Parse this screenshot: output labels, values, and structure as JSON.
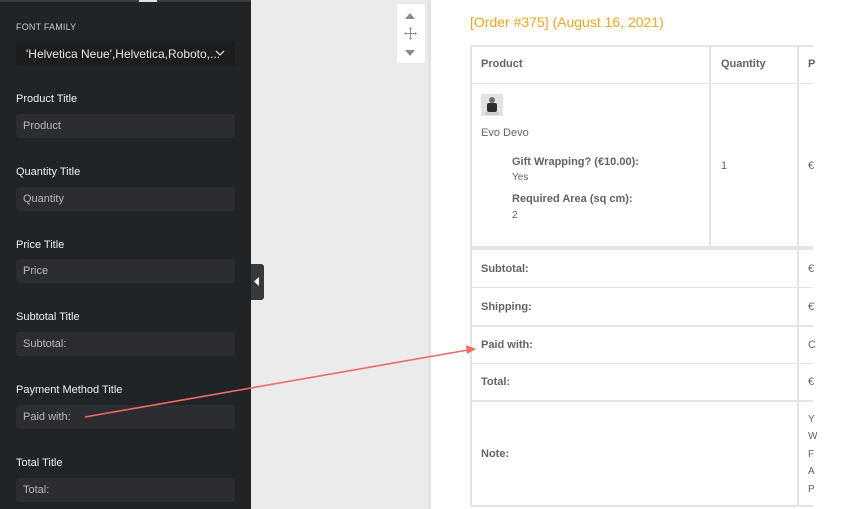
{
  "sidebar": {
    "font_family": {
      "label": "FONT FAMILY",
      "selected": "'Helvetica Neue',Helvetica,Roboto,..."
    },
    "fields": [
      {
        "label": "Product Title",
        "value": "Product"
      },
      {
        "label": "Quantity Title",
        "value": "Quantity"
      },
      {
        "label": "Price Title",
        "value": "Price"
      },
      {
        "label": "Subtotal Title",
        "value": "Subtotal:"
      },
      {
        "label": "Payment Method Title",
        "value": "Paid with:"
      },
      {
        "label": "Total Title",
        "value": "Total:"
      }
    ]
  },
  "preview": {
    "order_title": "[Order #375] (August 16, 2021)",
    "table": {
      "headers": [
        "Product",
        "Quantity",
        "P"
      ],
      "item": {
        "name": "Evo Devo",
        "meta": [
          {
            "label": "Gift Wrapping? (€10.00):",
            "value": "Yes"
          },
          {
            "label": "Required Area (sq cm):",
            "value": "2"
          }
        ],
        "quantity": "1",
        "price_partial": "€"
      },
      "totals": [
        {
          "label": "Subtotal:",
          "value_partial": "€"
        },
        {
          "label": "Shipping:",
          "value_partial": "€"
        },
        {
          "label": "Paid with:",
          "value_partial": "C"
        },
        {
          "label": "Total:",
          "value_partial": "€"
        }
      ],
      "note": {
        "label": "Note:",
        "lines_partial": [
          "Y",
          "W",
          "F",
          "A",
          "P"
        ]
      }
    }
  },
  "annotation": {
    "arrow_color": "#f06a6a"
  }
}
